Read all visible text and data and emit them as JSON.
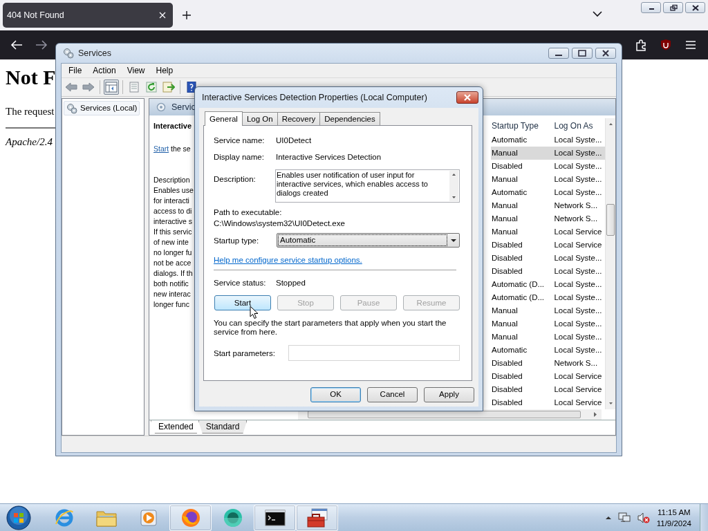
{
  "browser": {
    "tab_title": "404 Not Found",
    "page": {
      "heading": "Not F",
      "text": "The request",
      "footer": "Apache/2.4"
    }
  },
  "services_window": {
    "title": "Services",
    "menu": [
      "File",
      "Action",
      "View",
      "Help"
    ],
    "tree": [
      {
        "label": "Services (Local)",
        "selected": true
      }
    ],
    "pane_header": "Servic",
    "detail": {
      "name": "Interactive",
      "action_link": "Start",
      "action_rest": "the se",
      "description_lines": [
        "Description",
        "Enables use",
        "for interacti",
        "access to di",
        "interactive s",
        "If this servic",
        "of new inte",
        "no longer fu",
        "not be acce",
        "dialogs. If th",
        "both notific",
        "new interac",
        "longer func"
      ]
    },
    "list": {
      "columns": [
        "Startup Type",
        "Log On As"
      ],
      "rows": [
        {
          "startup_type": "Automatic",
          "log_on_as": "Local Syste...",
          "selected": false
        },
        {
          "startup_type": "Manual",
          "log_on_as": "Local Syste...",
          "selected": true
        },
        {
          "startup_type": "Disabled",
          "log_on_as": "Local Syste...",
          "selected": false
        },
        {
          "startup_type": "Manual",
          "log_on_as": "Local Syste...",
          "selected": false
        },
        {
          "startup_type": "Automatic",
          "log_on_as": "Local Syste...",
          "selected": false
        },
        {
          "startup_type": "Manual",
          "log_on_as": "Network S...",
          "selected": false
        },
        {
          "startup_type": "Manual",
          "log_on_as": "Network S...",
          "selected": false
        },
        {
          "startup_type": "Manual",
          "log_on_as": "Local Service",
          "selected": false
        },
        {
          "startup_type": "Disabled",
          "log_on_as": "Local Service",
          "selected": false
        },
        {
          "startup_type": "Disabled",
          "log_on_as": "Local Syste...",
          "selected": false
        },
        {
          "startup_type": "Disabled",
          "log_on_as": "Local Syste...",
          "selected": false
        },
        {
          "startup_type": "Automatic (D...",
          "log_on_as": "Local Syste...",
          "selected": false
        },
        {
          "startup_type": "Automatic (D...",
          "log_on_as": "Local Syste...",
          "selected": false
        },
        {
          "startup_type": "Manual",
          "log_on_as": "Local Syste...",
          "selected": false
        },
        {
          "startup_type": "Manual",
          "log_on_as": "Local Syste...",
          "selected": false
        },
        {
          "startup_type": "Manual",
          "log_on_as": "Local Syste...",
          "selected": false
        },
        {
          "startup_type": "Automatic",
          "log_on_as": "Local Syste...",
          "selected": false
        },
        {
          "startup_type": "Disabled",
          "log_on_as": "Network S...",
          "selected": false
        },
        {
          "startup_type": "Disabled",
          "log_on_as": "Local Service",
          "selected": false
        },
        {
          "startup_type": "Disabled",
          "log_on_as": "Local Service",
          "selected": false
        },
        {
          "startup_type": "Disabled",
          "log_on_as": "Local Service",
          "selected": false
        }
      ]
    },
    "view_tabs": [
      {
        "label": "Extended",
        "selected": true
      },
      {
        "label": "Standard",
        "selected": false
      }
    ]
  },
  "dialog": {
    "title": "Interactive Services Detection Properties (Local Computer)",
    "tabs": [
      {
        "label": "General",
        "selected": true
      },
      {
        "label": "Log On",
        "selected": false
      },
      {
        "label": "Recovery",
        "selected": false
      },
      {
        "label": "Dependencies",
        "selected": false
      }
    ],
    "service_name": {
      "label": "Service name:",
      "value": "UI0Detect"
    },
    "display_name": {
      "label": "Display name:",
      "value": "Interactive Services Detection"
    },
    "description": {
      "label": "Description:",
      "value": "Enables user notification of user input for interactive services, which enables access to dialogs created"
    },
    "path": {
      "label": "Path to executable:",
      "value": "C:\\Windows\\system32\\UI0Detect.exe"
    },
    "startup_type": {
      "label": "Startup type:",
      "value": "Automatic"
    },
    "help_link": "Help me configure service startup options.",
    "service_status": {
      "label": "Service status:",
      "value": "Stopped"
    },
    "control_buttons": [
      {
        "label": "Start",
        "disabled": false
      },
      {
        "label": "Stop",
        "disabled": true
      },
      {
        "label": "Pause",
        "disabled": true
      },
      {
        "label": "Resume",
        "disabled": true
      }
    ],
    "note": "You can specify the start parameters that apply when you start the service from here.",
    "start_parameters": {
      "label": "Start parameters:"
    },
    "buttons": [
      {
        "label": "OK",
        "default": true
      },
      {
        "label": "Cancel",
        "default": false
      },
      {
        "label": "Apply",
        "default": false
      }
    ]
  },
  "taskbar": {
    "apps": [
      {
        "kind": "ie",
        "active": false
      },
      {
        "kind": "explorer",
        "active": false
      },
      {
        "kind": "media",
        "active": false
      },
      {
        "kind": "firefox",
        "active": true
      },
      {
        "kind": "circle",
        "active": false
      },
      {
        "kind": "terminal",
        "active": true
      },
      {
        "kind": "toolbox",
        "active": true
      }
    ],
    "clock": {
      "time": "11:15 AM",
      "date": "11/9/2024"
    }
  }
}
